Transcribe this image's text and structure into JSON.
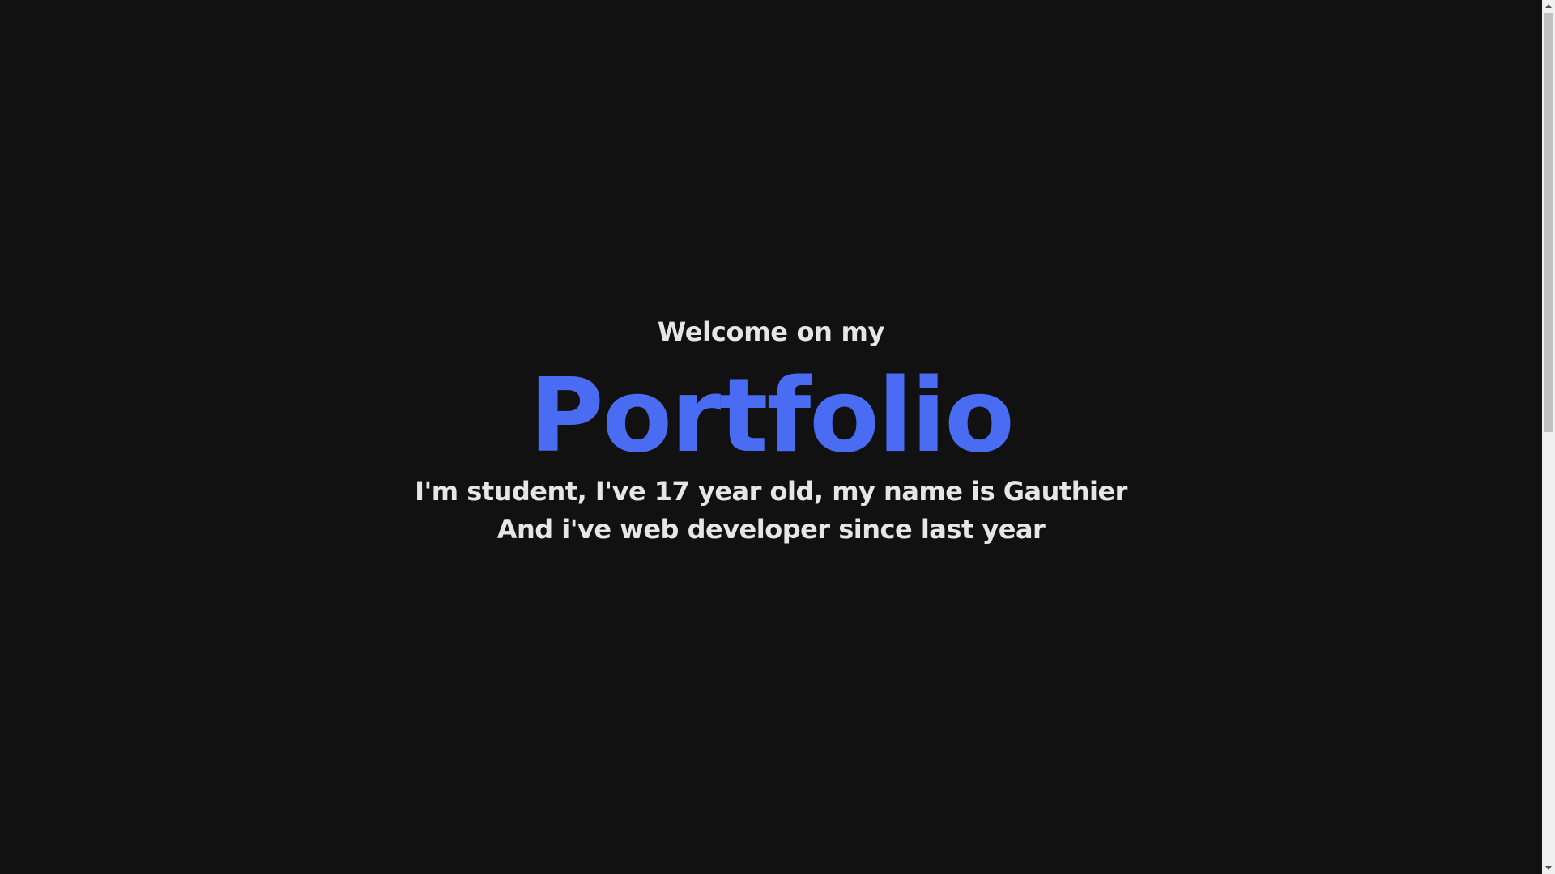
{
  "hero": {
    "welcome": "Welcome on my",
    "title": "Portfolio",
    "line1": "I'm student, I've 17 year old, my name is Gauthier",
    "line2": "And i've web developer since last year"
  },
  "colors": {
    "background": "#111112",
    "text": "#e6e6e6",
    "accent": "#4a6cf2"
  },
  "scrollbar": {
    "position_fraction": 0.0
  }
}
